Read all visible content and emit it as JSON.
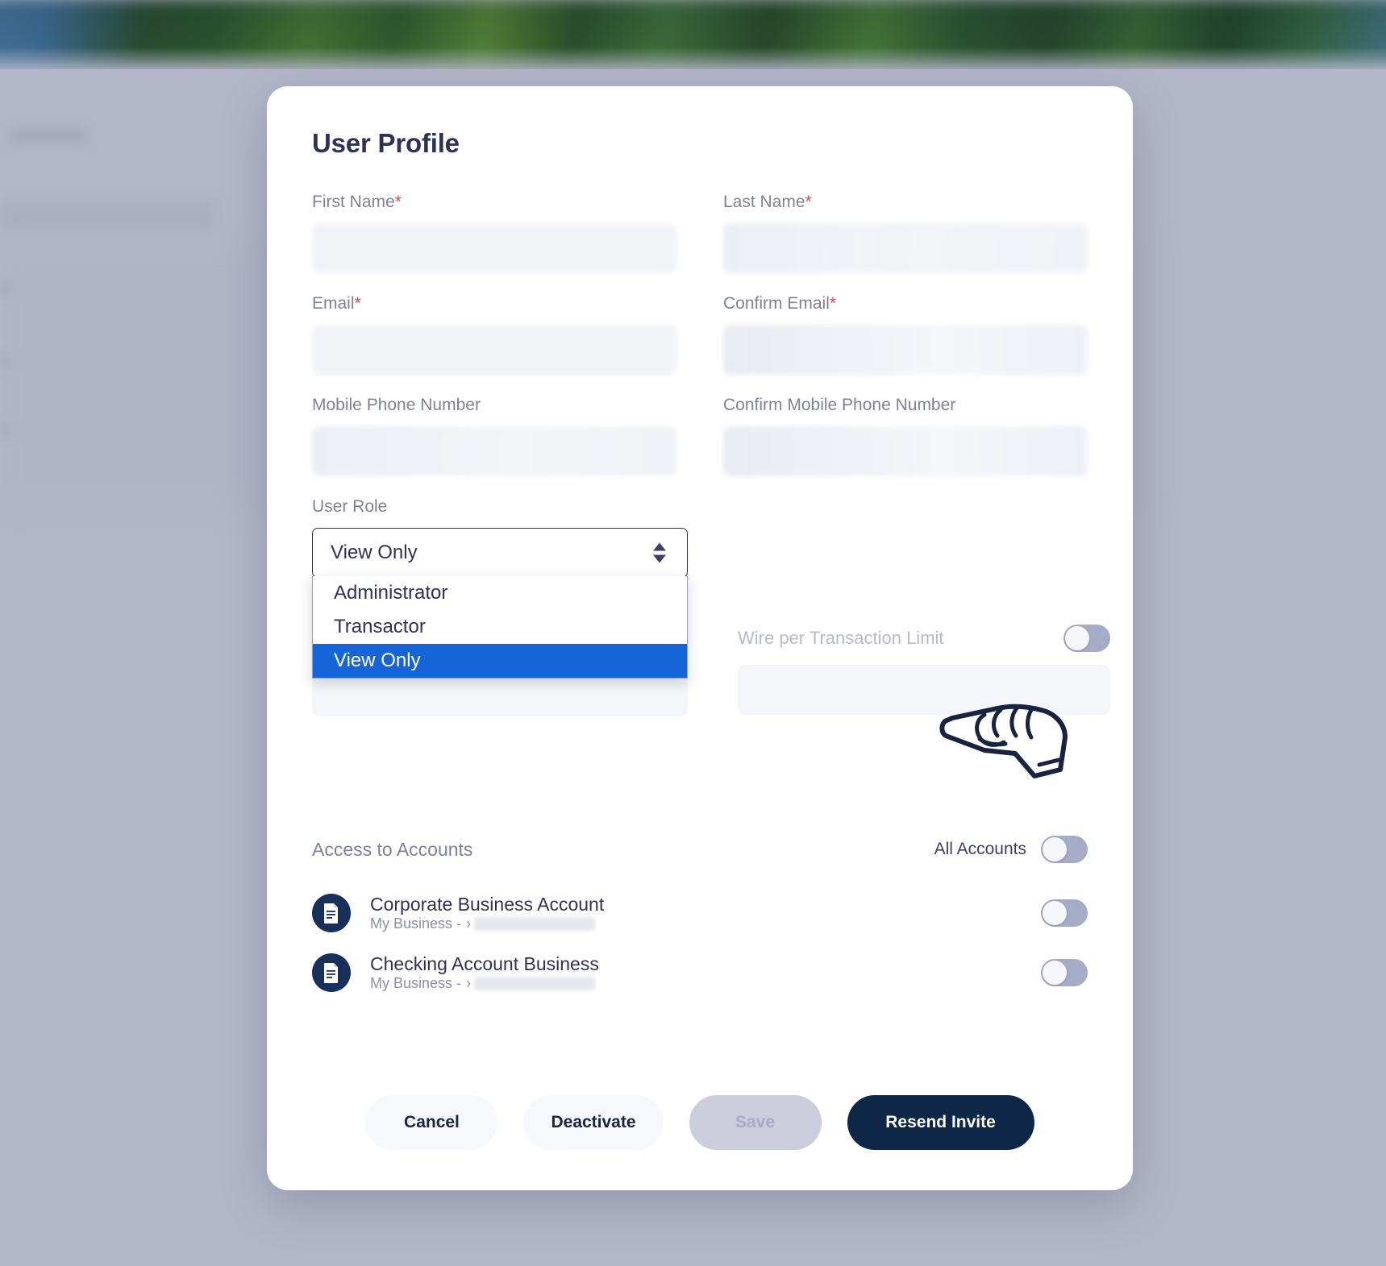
{
  "modal": {
    "title": "User Profile",
    "fields": [
      {
        "label": "First Name",
        "required": true,
        "value": ""
      },
      {
        "label": "Last Name",
        "required": true,
        "value": ""
      },
      {
        "label": "Email",
        "required": true,
        "value": ""
      },
      {
        "label": "Confirm Email",
        "required": true,
        "value": ""
      },
      {
        "label": "Mobile Phone Number",
        "required": false,
        "value": ""
      },
      {
        "label": "Confirm Mobile Phone Number",
        "required": false,
        "value": ""
      }
    ],
    "user_role": {
      "label": "User Role",
      "selected": "View Only",
      "expanded": true,
      "options": [
        "Administrator",
        "Transactor",
        "View Only"
      ]
    },
    "wire_limit": {
      "label": "Wire per Transaction Limit",
      "toggle_on": false,
      "value": ""
    },
    "access": {
      "title": "Access to Accounts",
      "all_accounts_label": "All Accounts",
      "all_accounts_on": false,
      "accounts": [
        {
          "name": "Corporate Business Account",
          "sub_prefix": "My Business -",
          "sub_masked": "›",
          "icon": "statement-icon",
          "toggle_on": false
        },
        {
          "name": "Checking Account Business",
          "sub_prefix": "My Business -",
          "sub_masked": "›",
          "icon": "statement-icon",
          "toggle_on": false
        }
      ]
    },
    "buttons": {
      "cancel": "Cancel",
      "deactivate": "Deactivate",
      "save": "Save",
      "resend": "Resend Invite"
    }
  },
  "cursor": {
    "icon": "pointing-hand-cursor"
  },
  "colors": {
    "accent_navy": "#2e3257",
    "primary_button": "#0e2746",
    "highlight_blue": "#1565d8",
    "required_red": "#e8414b",
    "toggle_off": "#a6abc8",
    "overlay": "#b4b7c9"
  }
}
